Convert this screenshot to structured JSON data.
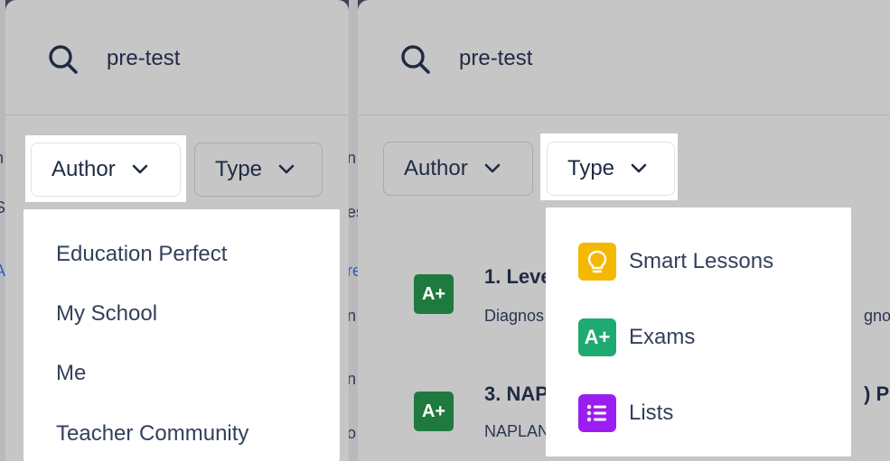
{
  "background": {
    "left_fragments": [
      "h",
      "S",
      "A"
    ],
    "between_fragments": [
      "n",
      "es",
      "re",
      "n",
      "n",
      "o"
    ]
  },
  "left_panel": {
    "search": {
      "value": "pre-test",
      "icon": "search-icon"
    },
    "filters": [
      {
        "label": "Author",
        "icon": "chevron-down-icon",
        "active": true
      },
      {
        "label": "Type",
        "icon": "chevron-down-icon",
        "active": false
      }
    ],
    "author_menu": {
      "items": [
        "Education Perfect",
        "My School",
        "Me",
        "Teacher Community"
      ]
    }
  },
  "right_panel": {
    "search": {
      "value": "pre-test",
      "icon": "search-icon"
    },
    "filters": [
      {
        "label": "Author",
        "icon": "chevron-down-icon",
        "active": false
      },
      {
        "label": "Type",
        "icon": "chevron-down-icon",
        "active": true
      }
    ],
    "type_menu": {
      "items": [
        {
          "label": "Smart Lessons",
          "icon": "lightbulb-icon",
          "color": "#f5b800"
        },
        {
          "label": "Exams",
          "icon": "exam-a-plus-icon",
          "glyph": "A+",
          "color": "#1faa72"
        },
        {
          "label": "Lists",
          "icon": "list-icon",
          "color": "#9b1ef0"
        }
      ]
    },
    "results": [
      {
        "title": "1. Leve",
        "subtitle": "Diagnos",
        "overflow_text": "gno",
        "icon": "exam-a-plus-icon",
        "glyph": "A+"
      },
      {
        "title": "3. NAP",
        "subtitle": "NAPLAN",
        "overflow_text": ") P",
        "icon": "exam-a-plus-icon",
        "glyph": "A+"
      }
    ]
  },
  "colors": {
    "panel_bg": "#c6c6c6",
    "text_dark": "#1f2a44",
    "exam_green_dark": "#1f7a3f",
    "smart_lessons_yellow": "#f5b800",
    "exams_green": "#1faa72",
    "lists_purple": "#9b1ef0"
  }
}
